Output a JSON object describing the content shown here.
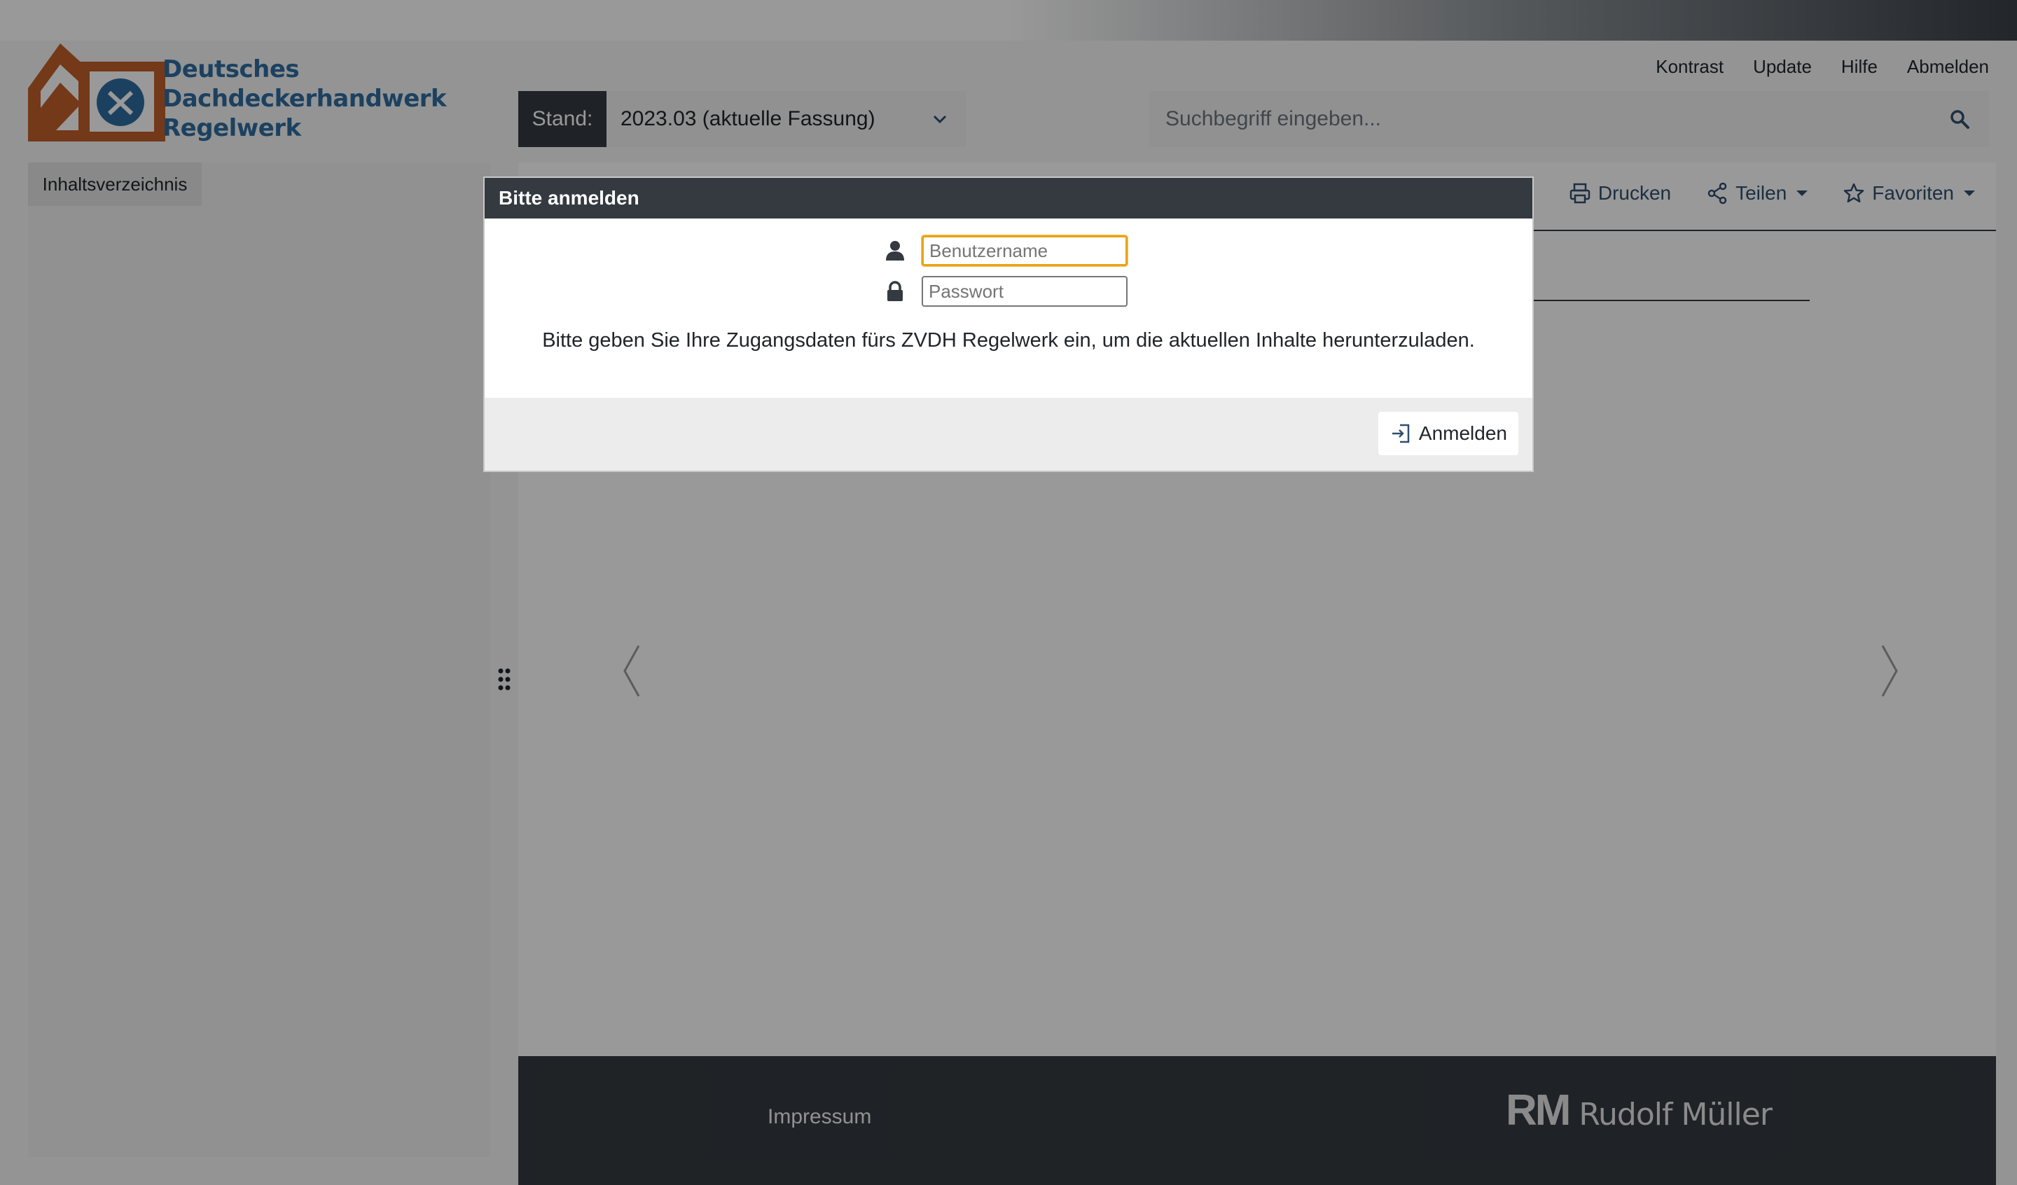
{
  "header": {
    "logo_lines": [
      "Deutsches",
      "Dachdeckerhandwerk",
      "Regelwerk"
    ],
    "topnav": [
      "Kontrast",
      "Update",
      "Hilfe",
      "Abmelden"
    ]
  },
  "stand": {
    "label": "Stand:",
    "selected": "2023.03 (aktuelle Fassung)"
  },
  "search": {
    "placeholder": "Suchbegriff eingeben..."
  },
  "sidebar": {
    "tab_label": "Inhaltsverzeichnis"
  },
  "toolbar": {
    "print_label": "Drucken",
    "share_label": "Teilen",
    "favorites_label": "Favoriten"
  },
  "footer": {
    "impressum": "Impressum",
    "publisher_mark": "RM",
    "publisher_name": "Rudolf Müller"
  },
  "modal": {
    "title": "Bitte anmelden",
    "username_placeholder": "Benutzername",
    "password_placeholder": "Passwort",
    "message": "Bitte geben Sie Ihre Zugangsdaten fürs ZVDH Regelwerk ein, um die aktuellen Inhalte herunterzuladen.",
    "login_label": "Anmelden"
  },
  "colors": {
    "brand_blue": "#2f6da0",
    "brand_orange": "#c0602a",
    "dark": "#343a40",
    "focus": "#e8a317"
  },
  "icons": [
    "search-icon",
    "chevron-down-icon",
    "printer-icon",
    "share-icon",
    "star-icon",
    "user-icon",
    "lock-icon",
    "sign-in-icon",
    "grip-icon"
  ]
}
